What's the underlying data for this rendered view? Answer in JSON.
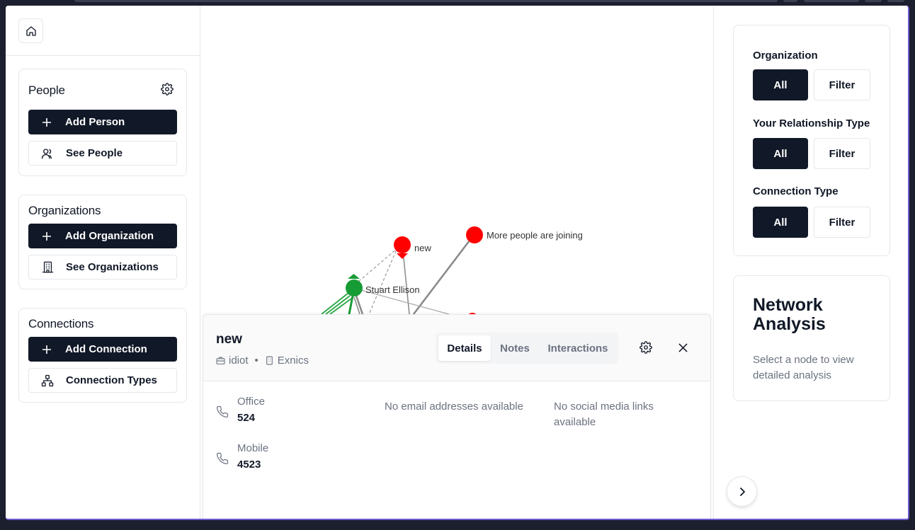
{
  "sidebar": {
    "home_icon": "home-icon",
    "people": {
      "title": "People",
      "add_label": "Add Person",
      "see_label": "See People"
    },
    "organizations": {
      "title": "Organizations",
      "add_label": "Add Organization",
      "see_label": "See Organizations"
    },
    "connections": {
      "title": "Connections",
      "add_label": "Add Connection",
      "types_label": "Connection Types"
    }
  },
  "graph": {
    "nodes": [
      {
        "label": "new",
        "color": "#ff0000"
      },
      {
        "label": "More people are joining",
        "color": "#ff0000"
      },
      {
        "label": "Stuart Ellison",
        "color": "#179c35"
      }
    ]
  },
  "details": {
    "name": "new",
    "role": "idiot",
    "organization": "Exnics",
    "separator": "•",
    "tabs": [
      "Details",
      "Notes",
      "Interactions"
    ],
    "active_tab": "Details",
    "phones": [
      {
        "label": "Office",
        "value": "524"
      },
      {
        "label": "Mobile",
        "value": "4523"
      }
    ],
    "no_email": "No email addresses available",
    "no_social": "No social media links available"
  },
  "filters": {
    "organization": {
      "label": "Organization",
      "all": "All",
      "filter": "Filter"
    },
    "relationship": {
      "label": "Your Relationship Type",
      "all": "All",
      "filter": "Filter"
    },
    "connection": {
      "label": "Connection Type",
      "all": "All",
      "filter": "Filter"
    }
  },
  "analysis": {
    "title": "Network Analysis",
    "description": "Select a node to view detailed analysis"
  },
  "colors": {
    "primary": "#111827",
    "node_red": "#ff0000",
    "node_green": "#179c35",
    "frame_accent": "#6d5bd0"
  }
}
